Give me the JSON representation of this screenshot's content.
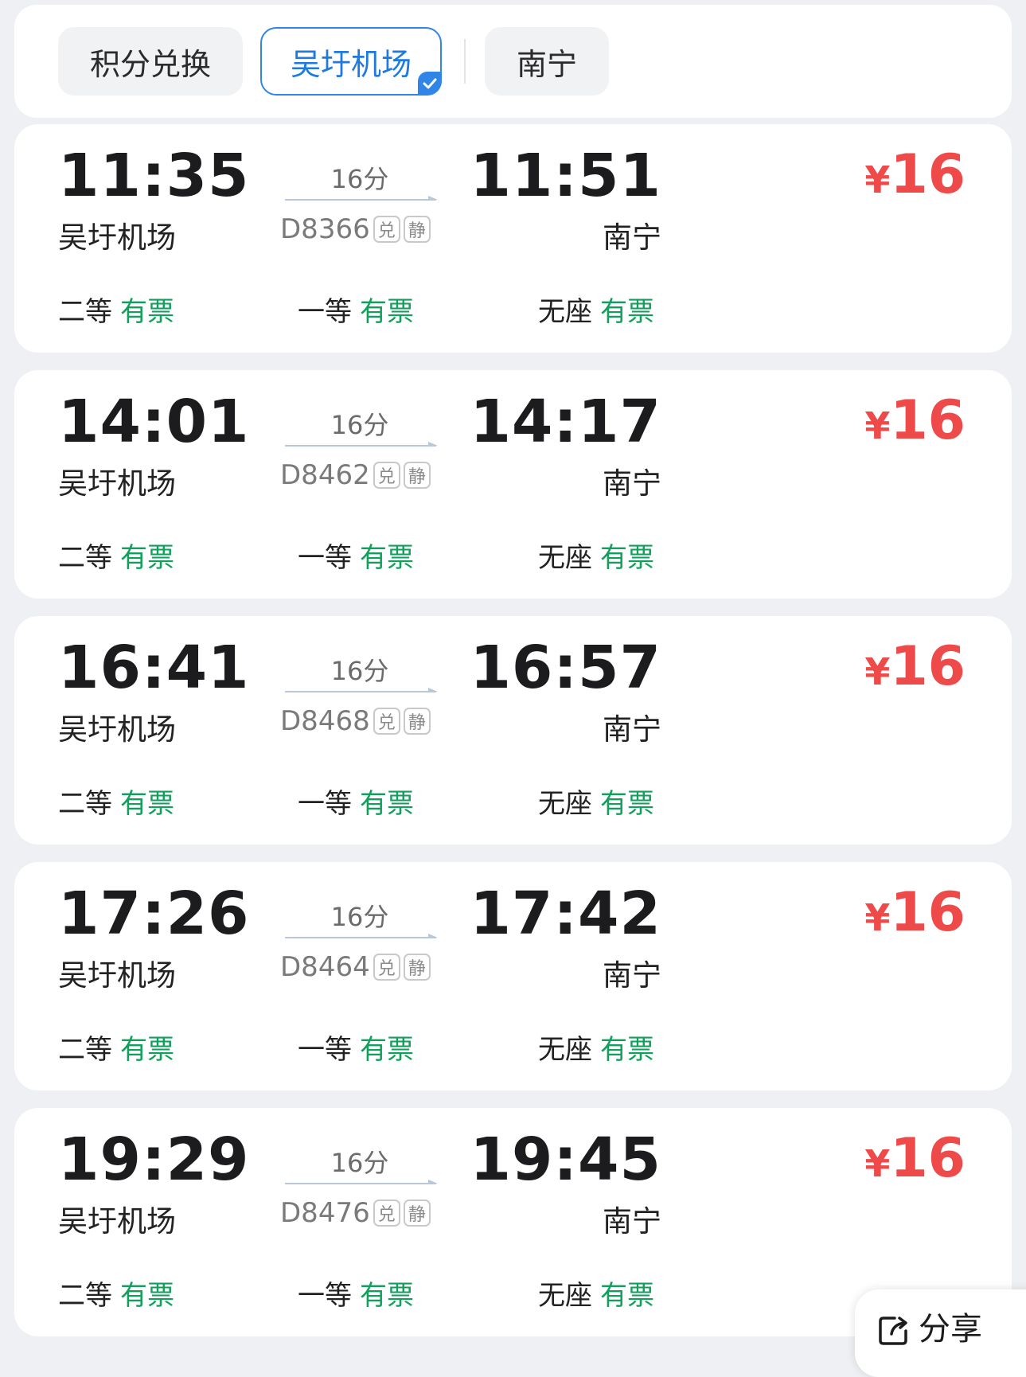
{
  "filters": [
    {
      "label": "积分兑换",
      "selected": false
    },
    {
      "label": "吴圩机场",
      "selected": true
    },
    {
      "label": "南宁",
      "selected": false
    }
  ],
  "trains": [
    {
      "dep_time": "11:35",
      "dep_station": "吴圩机场",
      "duration": "16分",
      "train_no": "D8366",
      "tags": [
        "兑",
        "静"
      ],
      "arr_time": "11:51",
      "arr_station": "南宁",
      "price_symbol": "¥",
      "price": "16",
      "seats": [
        {
          "class": "二等",
          "status": "有票"
        },
        {
          "class": "一等",
          "status": "有票"
        },
        {
          "class": "无座",
          "status": "有票"
        }
      ]
    },
    {
      "dep_time": "14:01",
      "dep_station": "吴圩机场",
      "duration": "16分",
      "train_no": "D8462",
      "tags": [
        "兑",
        "静"
      ],
      "arr_time": "14:17",
      "arr_station": "南宁",
      "price_symbol": "¥",
      "price": "16",
      "seats": [
        {
          "class": "二等",
          "status": "有票"
        },
        {
          "class": "一等",
          "status": "有票"
        },
        {
          "class": "无座",
          "status": "有票"
        }
      ]
    },
    {
      "dep_time": "16:41",
      "dep_station": "吴圩机场",
      "duration": "16分",
      "train_no": "D8468",
      "tags": [
        "兑",
        "静"
      ],
      "arr_time": "16:57",
      "arr_station": "南宁",
      "price_symbol": "¥",
      "price": "16",
      "seats": [
        {
          "class": "二等",
          "status": "有票"
        },
        {
          "class": "一等",
          "status": "有票"
        },
        {
          "class": "无座",
          "status": "有票"
        }
      ]
    },
    {
      "dep_time": "17:26",
      "dep_station": "吴圩机场",
      "duration": "16分",
      "train_no": "D8464",
      "tags": [
        "兑",
        "静"
      ],
      "arr_time": "17:42",
      "arr_station": "南宁",
      "price_symbol": "¥",
      "price": "16",
      "seats": [
        {
          "class": "二等",
          "status": "有票"
        },
        {
          "class": "一等",
          "status": "有票"
        },
        {
          "class": "无座",
          "status": "有票"
        }
      ]
    },
    {
      "dep_time": "19:29",
      "dep_station": "吴圩机场",
      "duration": "16分",
      "train_no": "D8476",
      "tags": [
        "兑",
        "静"
      ],
      "arr_time": "19:45",
      "arr_station": "南宁",
      "price_symbol": "¥",
      "price": "16",
      "seats": [
        {
          "class": "二等",
          "status": "有票"
        },
        {
          "class": "一等",
          "status": "有票"
        },
        {
          "class": "无座",
          "status": "有票"
        }
      ]
    }
  ],
  "share": {
    "label": "分享",
    "icon": "share-icon"
  },
  "colors": {
    "accent": "#2f86e6",
    "price": "#ef4a4a",
    "available": "#10a05b"
  }
}
